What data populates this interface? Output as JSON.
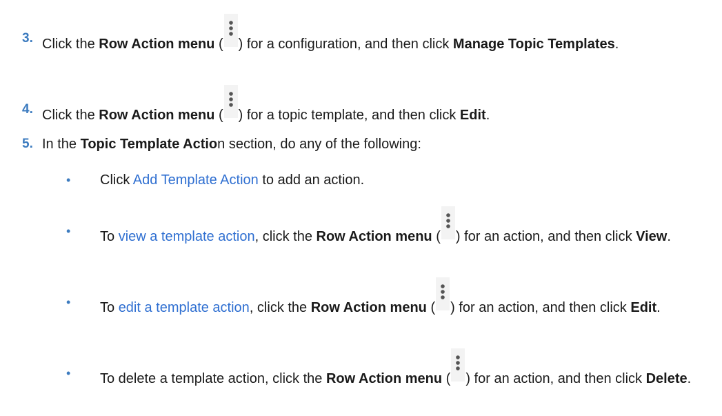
{
  "steps": [
    {
      "num": "3.",
      "t1": "Click the ",
      "b1": "Row Action menu",
      "t2": " (",
      "t3": ") for a configuration, and then click ",
      "b2": "Manage Topic Templates",
      "t4": "."
    },
    {
      "num": "4.",
      "t1": "Click the ",
      "b1": "Row Action menu",
      "t2": " (",
      "t3": ") for a topic template, and then click ",
      "b2": "Edit",
      "t4": "."
    },
    {
      "num": "5.",
      "t1": "In the ",
      "b1": "Topic Template Actio",
      "t2": "n section, do any of the following:"
    }
  ],
  "bullets": [
    {
      "dot": "•",
      "link": "Add Template Action",
      "t1": "Click ",
      "t2": " to add an action."
    },
    {
      "dot": "•",
      "t1": "To ",
      "link": "view a template action",
      "t2": ", click the ",
      "b1": "Row Action menu",
      "t3": " (",
      "t4": ") for an action, and then click ",
      "b2": "View",
      "t5": "."
    },
    {
      "dot": "•",
      "t1": "To ",
      "link": "edit a template action",
      "t2": ", click the ",
      "b1": "Row Action menu",
      "t3": " (",
      "t4": ") for an action, and then click ",
      "b2": "Edit",
      "t5": "."
    },
    {
      "dot": "•",
      "t1": "To delete a template action, click the ",
      "b1": "Row Action menu",
      "t2": " (",
      "t3": ") for an action, and then click ",
      "b2": "Delete",
      "t4": "."
    }
  ],
  "icons": {
    "row_action": "vertical-ellipsis-icon"
  }
}
